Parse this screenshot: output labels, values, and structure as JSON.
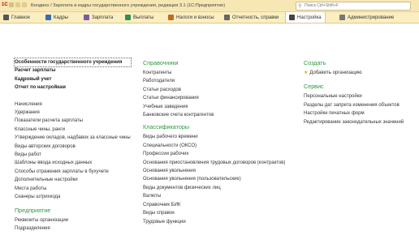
{
  "window": {
    "logo": "1C",
    "title": "Болдино / Зарплата и кадры государственного учреждения, редакция 3.1  (1С:Предприятие)",
    "search_placeholder": "Поиск Ctrl+Shift+F"
  },
  "menu": {
    "tabs": [
      {
        "label": "Главное",
        "icon_color": "#555555"
      },
      {
        "label": "Кадры",
        "icon_color": "#3a6cb0"
      },
      {
        "label": "Зарплата",
        "icon_color": "#7a5aa8"
      },
      {
        "label": "Выплаты",
        "icon_color": "#2e8f55"
      },
      {
        "label": "Налоги и взносы",
        "icon_color": "#c46a1f"
      },
      {
        "label": "Отчетность, справки",
        "icon_color": "#666666"
      },
      {
        "label": "Настройка",
        "icon_color": "#444444"
      },
      {
        "label": "Администрирование",
        "icon_color": "#777777"
      }
    ],
    "active_index": 6
  },
  "left": {
    "top_links": [
      "Особенности государственного учреждения",
      "Расчет зарплаты",
      "Кадровый учет",
      "Отчет по настройкам"
    ],
    "links": [
      "Начисления",
      "Удержания",
      "Показатели расчета зарплаты",
      "Классные чины, ранги",
      "Утверждение окладов, надбавок за классные чины",
      "Виды авторских договоров",
      "Виды работ",
      "Шаблоны ввода исходных данных",
      "Способы отражения зарплаты в бухучете",
      "Дополнительные настройки",
      "Места работы",
      "Сканеры штрихкода"
    ],
    "section2_heading": "Предприятие",
    "section2_links": [
      "Реквизиты организации",
      "Подразделения"
    ]
  },
  "middle": {
    "heading1": "Справочники",
    "links1": [
      "Контрагенты",
      "Работодатели",
      "Статьи расходов",
      "Статьи финансирования",
      "Учебные заведения",
      "Банковские счета контрагентов"
    ],
    "heading2": "Классификаторы",
    "links2": [
      "Виды рабочего времени",
      "Специальности (ОКСО)",
      "Профессии рабочих",
      "Основания приостановления трудовых договоров (контрактов)",
      "Основания увольнения",
      "Основания увольнения (пользовательские)",
      "Виды документов физических лиц",
      "Валюты",
      "Справочник БИК",
      "Виды справок",
      "Трудовые функции"
    ]
  },
  "right": {
    "heading1": "Создать",
    "create_link": "Добавить организацию",
    "heading2": "Сервис",
    "links": [
      "Персональные настройки",
      "Разделы дат запрета изменения объектов",
      "Настройки печатных форм",
      "Редактирование законодательных значений"
    ]
  }
}
